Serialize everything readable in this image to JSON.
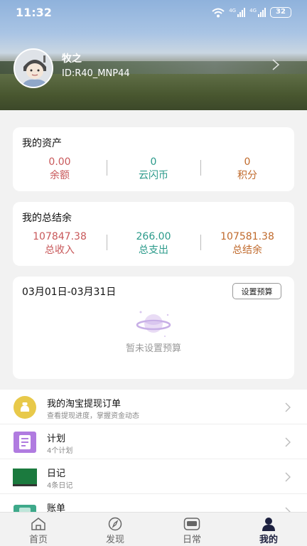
{
  "status": {
    "time": "11:32",
    "net1": "4G",
    "net2": "4G",
    "battery": "32"
  },
  "profile": {
    "name": "牧之",
    "id": "ID:R40_MNP44"
  },
  "assets": {
    "title": "我的资产",
    "items": [
      {
        "value": "0.00",
        "label": "余额",
        "color": "#c8585a"
      },
      {
        "value": "0",
        "label": "云闪币",
        "color": "#2a9a8a"
      },
      {
        "value": "0",
        "label": "积分",
        "color": "#c06a2c"
      }
    ]
  },
  "balance": {
    "title": "我的总结余",
    "items": [
      {
        "value": "107847.38",
        "label": "总收入",
        "color": "#c8585a"
      },
      {
        "value": "266.00",
        "label": "总支出",
        "color": "#2a9a8a"
      },
      {
        "value": "107581.38",
        "label": "总结余",
        "color": "#c06a2c"
      }
    ]
  },
  "budget": {
    "date_range": "03月01日-03月31日",
    "button_label": "设置预算",
    "empty_text": "暂未设置预算"
  },
  "list": [
    {
      "title": "我的淘宝提现订单",
      "subtitle": "查看提现进度，掌握资金动态",
      "icon": "money-bag-icon"
    },
    {
      "title": "计划",
      "subtitle": "4个计划",
      "icon": "plan-icon"
    },
    {
      "title": "日记",
      "subtitle": "4条日记",
      "icon": "diary-icon"
    },
    {
      "title": "账单",
      "subtitle": "",
      "icon": "bill-icon"
    }
  ],
  "tabs": [
    {
      "label": "首页",
      "icon": "home-icon",
      "active": false
    },
    {
      "label": "发现",
      "icon": "compass-icon",
      "active": false
    },
    {
      "label": "日常",
      "icon": "calendar-icon",
      "active": false
    },
    {
      "label": "我的",
      "icon": "user-icon",
      "active": true
    }
  ]
}
